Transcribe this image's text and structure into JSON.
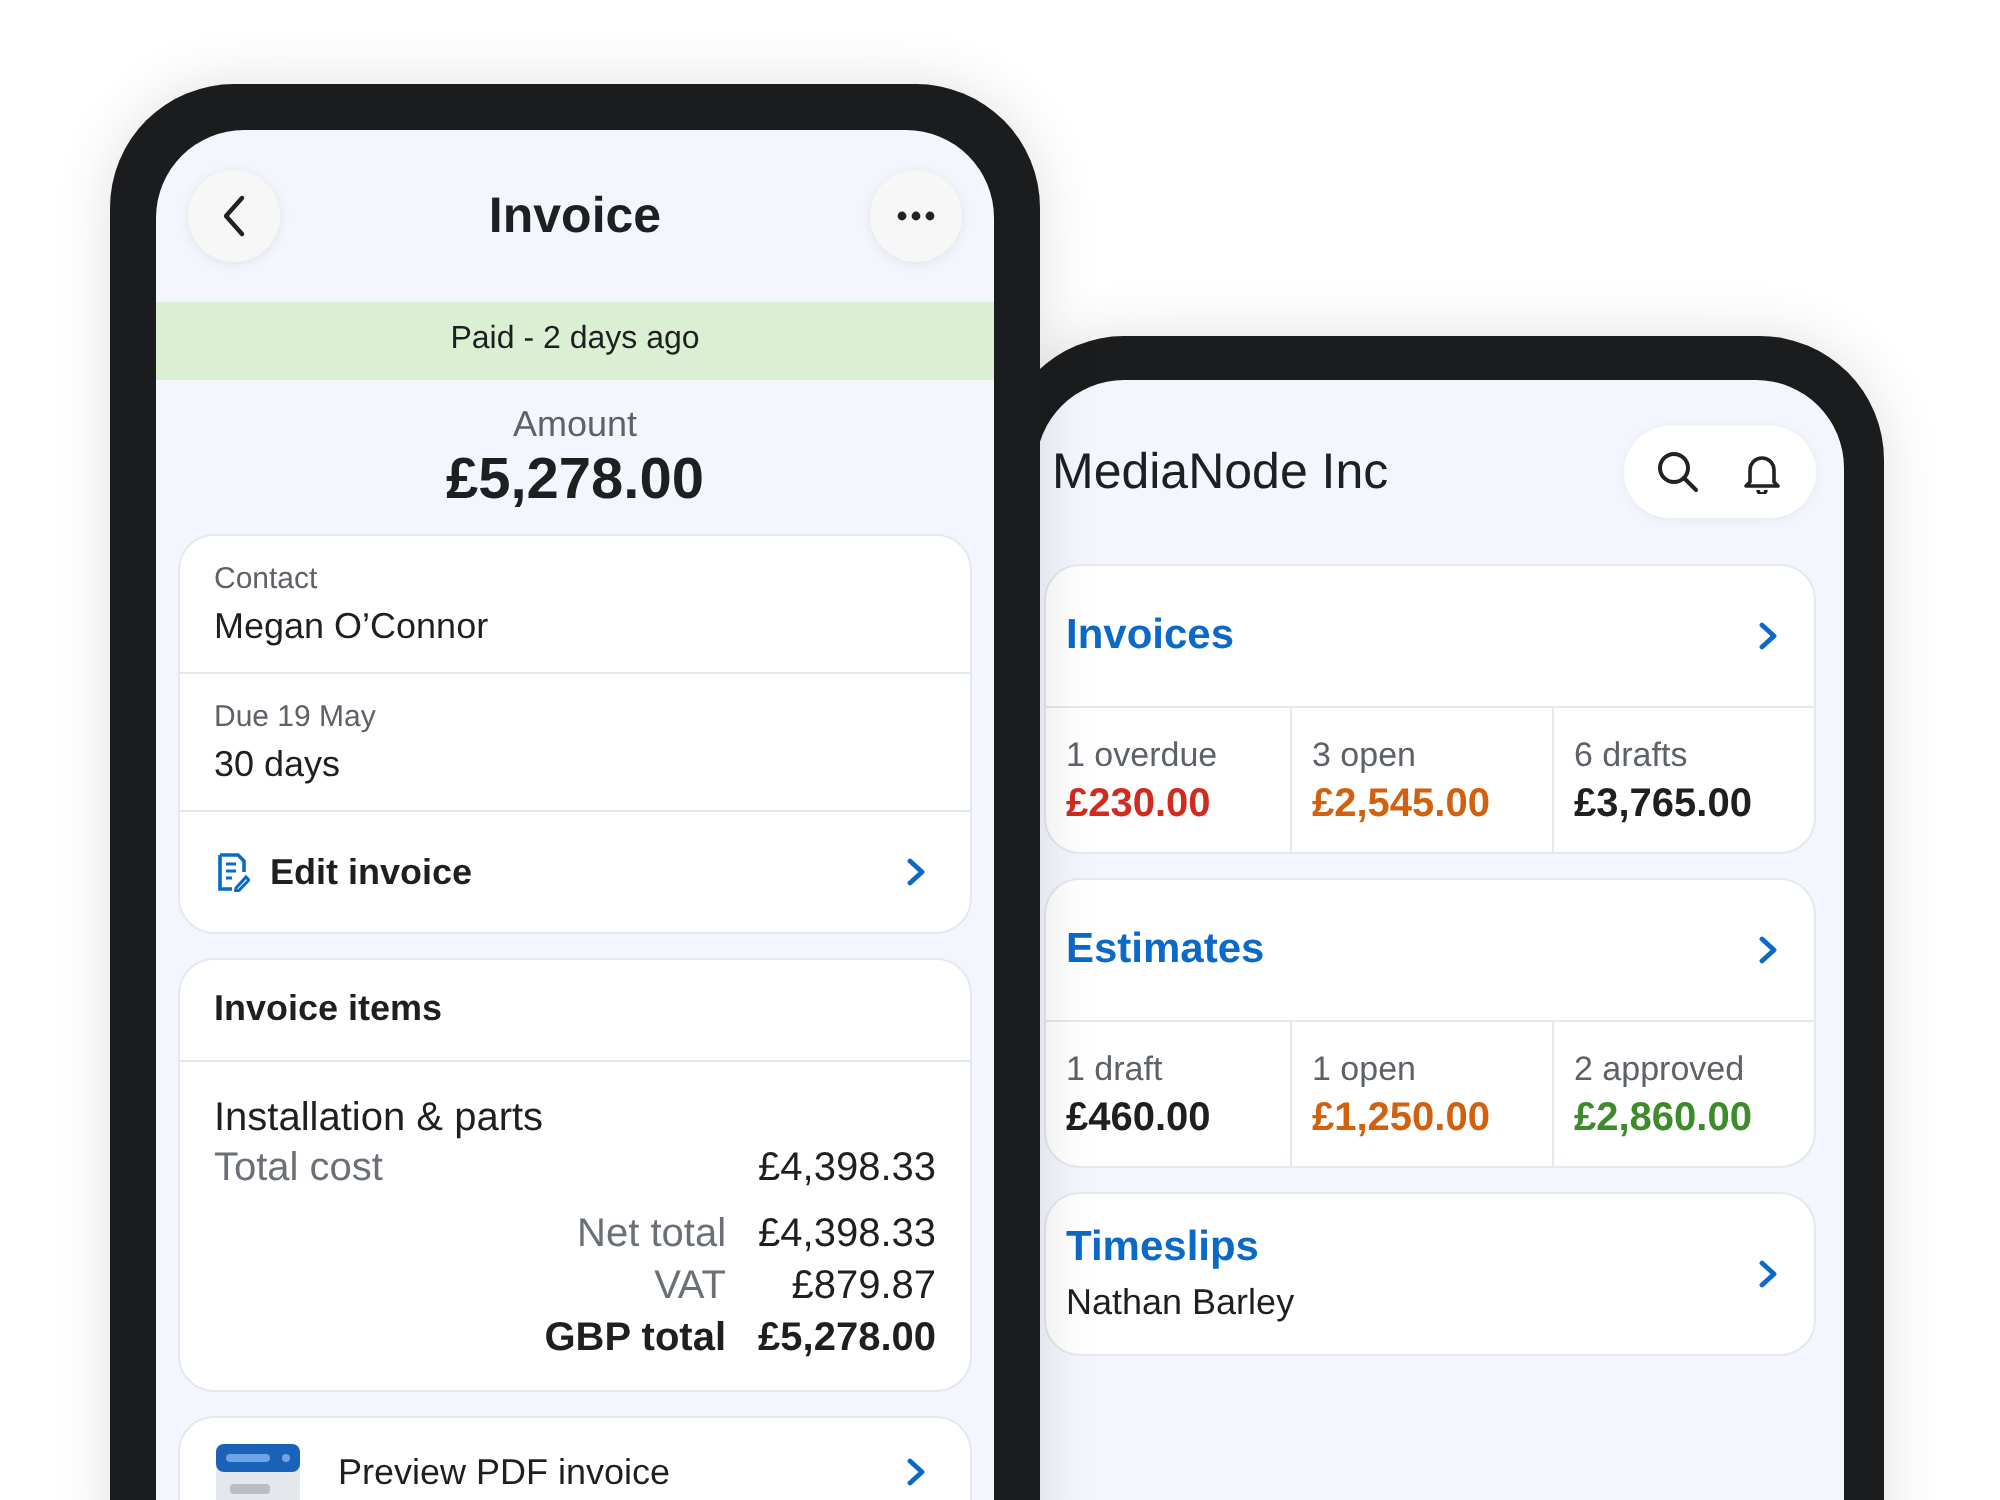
{
  "invoice_screen": {
    "title": "Invoice",
    "status_banner": "Paid - 2 days ago",
    "amount_label": "Amount",
    "amount": "£5,278.00",
    "details": [
      {
        "label": "Contact",
        "value": "Megan O’Connor"
      },
      {
        "label": "Due 19 May",
        "value": "30 days"
      }
    ],
    "edit_action": "Edit invoice",
    "items_card": {
      "title": "Invoice items",
      "items": [
        {
          "name": "Installation & parts",
          "cost_label": "Total cost",
          "cost": "£4,398.33"
        }
      ],
      "totals": [
        {
          "label": "Net total",
          "value": "£4,398.33",
          "emphasis": false
        },
        {
          "label": "VAT",
          "value": "£879.87",
          "emphasis": false
        },
        {
          "label": "GBP total",
          "value": "£5,278.00",
          "emphasis": true
        }
      ]
    },
    "preview_action": "Preview PDF invoice"
  },
  "dashboard_screen": {
    "title": "MediaNode Inc",
    "sections": [
      {
        "kind": "stats",
        "title": "Invoices",
        "stats": [
          {
            "label": "1 overdue",
            "amount": "£230.00",
            "color": "#d12a1f"
          },
          {
            "label": "3 open",
            "amount": "£2,545.00",
            "color": "#d1600f"
          },
          {
            "label": "6 drafts",
            "amount": "£3,765.00",
            "color": "#1e1f21"
          }
        ]
      },
      {
        "kind": "stats",
        "title": "Estimates",
        "stats": [
          {
            "label": "1 draft",
            "amount": "£460.00",
            "color": "#1e1f21"
          },
          {
            "label": "1 open",
            "amount": "£1,250.00",
            "color": "#d1600f"
          },
          {
            "label": "2 approved",
            "amount": "£2,860.00",
            "color": "#3e8b2b"
          }
        ]
      },
      {
        "kind": "subtitle",
        "title": "Timeslips",
        "subtitle": "Nathan Barley"
      }
    ]
  }
}
